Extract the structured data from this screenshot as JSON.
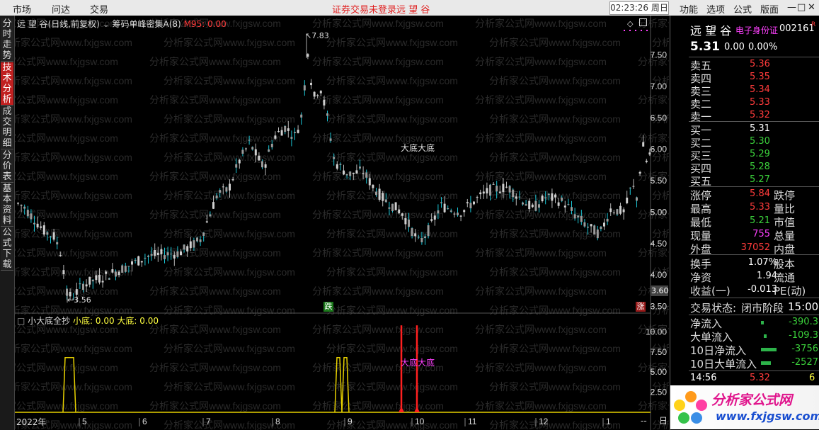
{
  "menubar": {
    "items": [
      "市场",
      "问达",
      "交易"
    ],
    "status": "证券交易未登录",
    "stock_name": "远 望 谷",
    "clock": "02:23:26 周日",
    "right_items": [
      "功能",
      "选项",
      "公式",
      "版面"
    ],
    "window_controls": [
      "—",
      "□",
      "✕"
    ]
  },
  "left_tabs": [
    {
      "label": "分时走势",
      "active": false
    },
    {
      "label": "技术分析",
      "active": true
    },
    {
      "label": "成交明细",
      "active": false
    },
    {
      "label": "分价表",
      "active": false
    },
    {
      "label": "基本资料",
      "active": false
    },
    {
      "label": "公式下载",
      "active": false
    }
  ],
  "main_chart": {
    "title": "远 望 谷(日线,前复权)",
    "indicator": "筹码单峰密集A(8)",
    "ma_label": "M95: 0.00",
    "high_label": "7.83",
    "low_label": "3.56",
    "center_label": "大底大底",
    "price_box": "3.60",
    "marker_down": "跌",
    "marker_up": "涨",
    "y_ticks": [
      "7.50",
      "7.00",
      "6.50",
      "6.00",
      "5.50",
      "5.00",
      "4.50",
      "4.00",
      "3.50"
    ],
    "watermark": "分析家公式网www.fxjgsw.com"
  },
  "sub_chart": {
    "title": "小大底全抄",
    "small_label": "小底: 0.00",
    "big_label": "大底: 0.00",
    "center_label": "大底大底",
    "y_ticks": [
      "10.00",
      "7.50",
      "5.00",
      "2.50"
    ]
  },
  "x_axis": {
    "labels": [
      "2022年",
      "5",
      "6",
      "7",
      "8",
      "9",
      "10",
      "11",
      "12",
      "1"
    ],
    "end_label": "--",
    "day_btn": "日"
  },
  "chart_data": {
    "type": "candlestick",
    "y_range": [
      3.5,
      7.8
    ],
    "high": 7.83,
    "low": 3.56,
    "close": 5.31
  },
  "quote": {
    "name": "远 望 谷",
    "tag": "电子身份证",
    "code": "002161",
    "r_badge": "R",
    "price": "5.31",
    "change": "0.00",
    "change_pct": "0.00%",
    "sells": [
      {
        "label": "卖五",
        "price": "5.36"
      },
      {
        "label": "卖四",
        "price": "5.35"
      },
      {
        "label": "卖三",
        "price": "5.34"
      },
      {
        "label": "卖二",
        "price": "5.33"
      },
      {
        "label": "卖一",
        "price": "5.32"
      }
    ],
    "buys": [
      {
        "label": "买一",
        "price": "5.31"
      },
      {
        "label": "买二",
        "price": "5.30"
      },
      {
        "label": "买三",
        "price": "5.29"
      },
      {
        "label": "买四",
        "price": "5.28"
      },
      {
        "label": "买五",
        "price": "5.27"
      }
    ],
    "stats": [
      {
        "l1": "涨停",
        "v1": "5.84",
        "l2": "跌停"
      },
      {
        "l1": "最高",
        "v1": "5.33",
        "l2": "量比"
      },
      {
        "l1": "最低",
        "v1": "5.21",
        "l2": "市值"
      },
      {
        "l1": "现量",
        "v1": "755",
        "l2": "总量"
      },
      {
        "l1": "外盘",
        "v1": "37052",
        "l2": "内盘"
      }
    ],
    "stats2": [
      {
        "l1": "换手",
        "v1": "1.07%",
        "l2": "股本"
      },
      {
        "l1": "净资",
        "v1": "1.94",
        "l2": "流通"
      },
      {
        "l1": "收益(一)",
        "v1": "-0.013",
        "l2": "PE(动)"
      }
    ],
    "trade_status_label": "交易状态:",
    "trade_status": "闭市阶段",
    "trade_time": "15:00",
    "flows": [
      {
        "label": "净流入",
        "value": "-390.3"
      },
      {
        "label": "大单流入",
        "value": "-109.3"
      },
      {
        "label": "10日净流入",
        "value": "-3756"
      },
      {
        "label": "10日大单流入",
        "value": "-2527"
      }
    ],
    "tick_time": "14:56",
    "tick_price": "5.32",
    "tick_extra": "6",
    "logo_text": "分析家公式网",
    "logo_url": "www.fxjgsw.com"
  }
}
